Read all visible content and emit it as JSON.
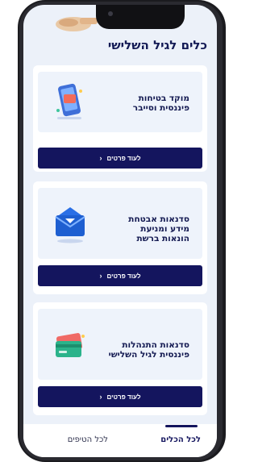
{
  "header": {
    "title": "כלים לגיל השלישי"
  },
  "cards": [
    {
      "title_line1": "מוקד בטיחות",
      "title_line2": "פיננסית וסייבר",
      "title_line3": "",
      "button_label": "לעוד פרטים",
      "icon": "phone-shield-icon"
    },
    {
      "title_line1": "סדנאות אבטחת",
      "title_line2": "מידע ומניעת",
      "title_line3": "הונאות ברשת",
      "button_label": "לעוד פרטים",
      "icon": "envelope-icon"
    },
    {
      "title_line1": "סדנאות התנהלות",
      "title_line2": "פיננסית לגיל השלישי",
      "title_line3": "",
      "button_label": "לעוד פרטים",
      "icon": "credit-cards-icon"
    }
  ],
  "tabbar": {
    "tools_label": "לכל הכלים",
    "tips_label": "לכל הטיפים",
    "active": "tools"
  },
  "colors": {
    "navy": "#14155e",
    "background": "#ecf1f9"
  }
}
